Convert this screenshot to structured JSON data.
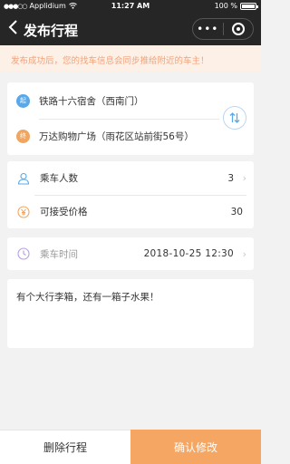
{
  "status_bar": {
    "carrier": "Applidium",
    "time": "11:27 AM",
    "battery": "100 %",
    "battery_level": 1.0
  },
  "nav": {
    "title": "发布行程",
    "more_glyph": "•••"
  },
  "notice": "发布成功后，您的找车信息会同步推给附近的车主！",
  "route": {
    "start_badge": "起",
    "start": "铁路十六宿舍（西南门）",
    "end_badge": "终",
    "end": "万达购物广场（雨花区站前街56号）"
  },
  "passengers": {
    "label": "乘车人数",
    "value": "3"
  },
  "price": {
    "label": "可接受价格",
    "value": "30"
  },
  "departure": {
    "label": "乘车时间",
    "value": "2018-10-25  12:30"
  },
  "remark": "有个大行李箱，还有一箱子水果！",
  "actions": {
    "delete": "删除行程",
    "confirm": "确认修改"
  },
  "colors": {
    "accent": "#f5a662",
    "start_badge": "#5aa8e8",
    "end_badge": "#f2a55e",
    "notice_text": "#f2a27a",
    "notice_bg": "#fdf0e6"
  }
}
